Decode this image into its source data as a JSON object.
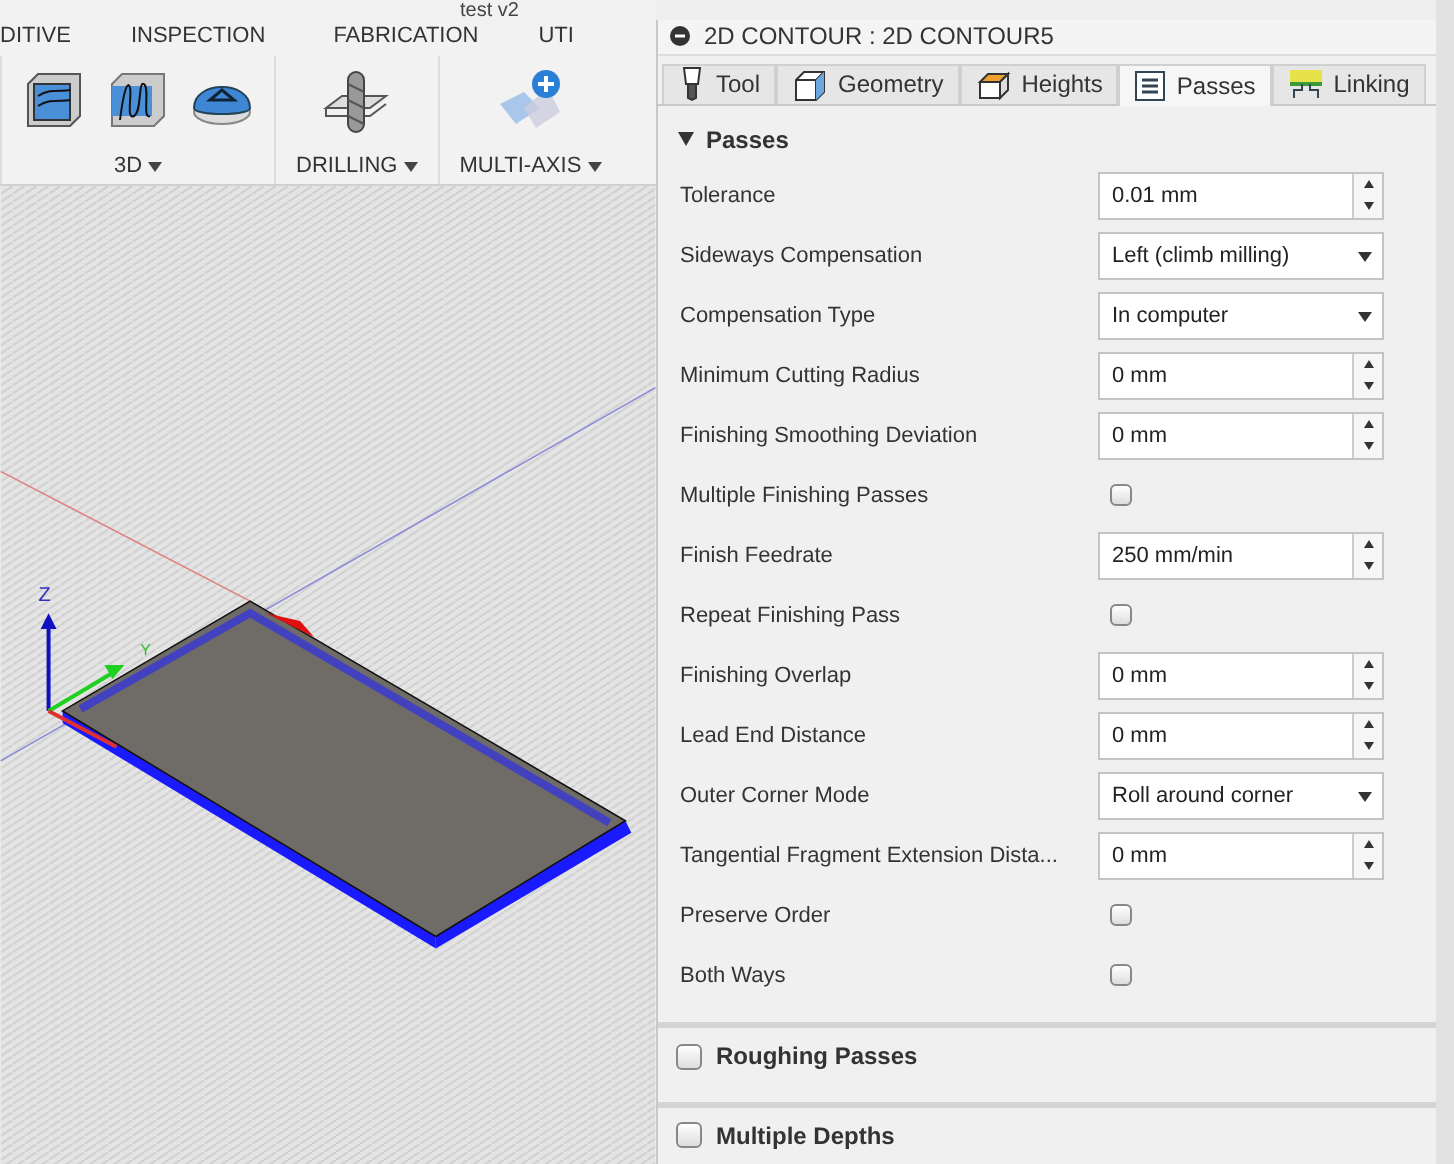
{
  "window": {
    "title": "test v2"
  },
  "toolbar": {
    "tabs": [
      "DITIVE",
      "INSPECTION",
      "FABRICATION",
      "UTI"
    ],
    "groups": [
      {
        "label": "3D"
      },
      {
        "label": "DRILLING"
      },
      {
        "label": "MULTI-AXIS"
      }
    ]
  },
  "viewport": {
    "axis_labels": [
      "Z",
      "Y"
    ]
  },
  "panel": {
    "title": "2D CONTOUR : 2D CONTOUR5",
    "tabs": [
      {
        "label": "Tool",
        "selected": false
      },
      {
        "label": "Geometry",
        "selected": false
      },
      {
        "label": "Heights",
        "selected": false
      },
      {
        "label": "Passes",
        "selected": true
      },
      {
        "label": "Linking",
        "selected": false
      }
    ],
    "section": {
      "title": "Passes",
      "expanded": true,
      "rows": [
        {
          "kind": "spin",
          "label": "Tolerance",
          "value": "0.01 mm"
        },
        {
          "kind": "dropdown",
          "label": "Sideways Compensation",
          "value": "Left (climb milling)"
        },
        {
          "kind": "dropdown",
          "label": "Compensation Type",
          "value": "In computer"
        },
        {
          "kind": "spin",
          "label": "Minimum Cutting Radius",
          "value": "0 mm"
        },
        {
          "kind": "spin",
          "label": "Finishing Smoothing Deviation",
          "value": "0 mm"
        },
        {
          "kind": "check",
          "label": "Multiple Finishing Passes",
          "checked": false
        },
        {
          "kind": "spin",
          "label": "Finish Feedrate",
          "value": "250 mm/min"
        },
        {
          "kind": "check",
          "label": "Repeat Finishing Pass",
          "checked": false
        },
        {
          "kind": "spin",
          "label": "Finishing Overlap",
          "value": "0 mm"
        },
        {
          "kind": "spin",
          "label": "Lead End Distance",
          "value": "0 mm"
        },
        {
          "kind": "dropdown",
          "label": "Outer Corner Mode",
          "value": "Roll around corner"
        },
        {
          "kind": "spin",
          "label": "Tangential Fragment Extension Dista...",
          "value": "0 mm"
        },
        {
          "kind": "check",
          "label": "Preserve Order",
          "checked": false
        },
        {
          "kind": "check",
          "label": "Both Ways",
          "checked": false
        }
      ]
    },
    "groups": [
      {
        "title": "Roughing Passes",
        "checked": false
      },
      {
        "title": "Multiple Depths",
        "checked": false
      }
    ]
  }
}
